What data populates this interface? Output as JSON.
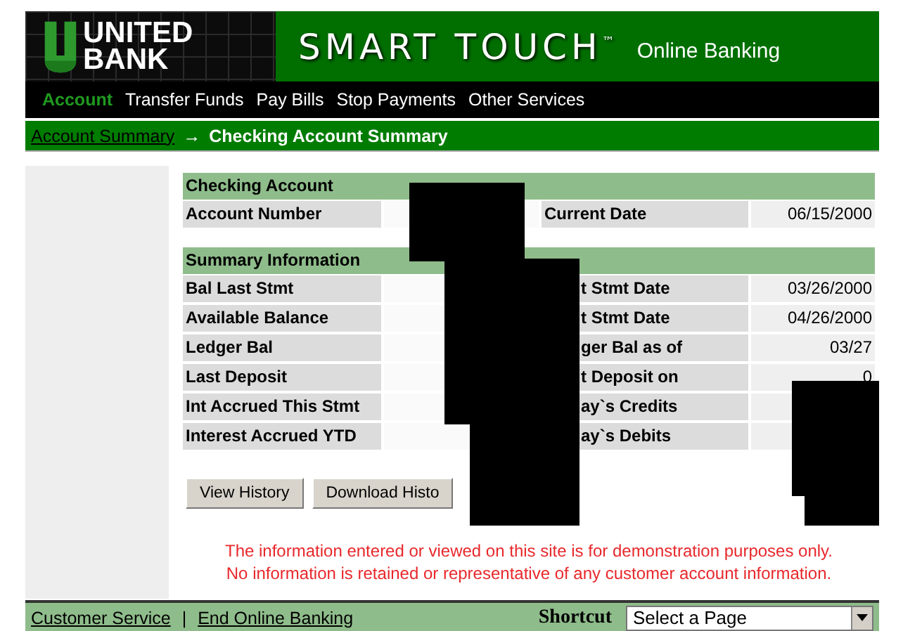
{
  "header": {
    "logo_lines": [
      "UNITED",
      "BANK"
    ],
    "product": "SMART TOUCH",
    "trademark": "™",
    "tagline": "Online Banking"
  },
  "nav": [
    {
      "label": "Account",
      "selected": true
    },
    {
      "label": "Transfer Funds",
      "selected": false
    },
    {
      "label": "Pay Bills",
      "selected": false
    },
    {
      "label": "Stop Payments",
      "selected": false
    },
    {
      "label": "Other Services",
      "selected": false
    }
  ],
  "breadcrumb": {
    "link": "Account Summary",
    "separator": "→",
    "current": "Checking Account Summary"
  },
  "sections": [
    {
      "title": "Checking Account",
      "rows": [
        {
          "label": "Account Number",
          "label_2": "Current Date",
          "value_2": "06/15/2000"
        }
      ]
    },
    {
      "title": "Summary Information",
      "rows": [
        {
          "label": "Bal Last Stmt",
          "label_2": "t Stmt Date",
          "value_2": "03/26/2000"
        },
        {
          "label": "Available Balance",
          "label_2": "t Stmt Date",
          "value_2": "04/26/2000"
        },
        {
          "label": "Ledger Bal",
          "label_2": "ger Bal as of",
          "value_2": "03/27"
        },
        {
          "label": "Last Deposit",
          "label_2": "t Deposit on",
          "value_2": "0"
        },
        {
          "label": "Int Accrued This Stmt",
          "label_2": "ay`s Credits"
        },
        {
          "label": "Interest Accrued YTD",
          "label_2": "ay`s Debits"
        }
      ]
    }
  ],
  "buttons": [
    "View History",
    "Download Histo"
  ],
  "notice": [
    "The information entered or viewed on this site is for demonstration purposes only.",
    "No information is retained or representative of any customer account information."
  ],
  "footer": {
    "links": [
      "Customer Service",
      "End Online Banking"
    ],
    "separator": "|",
    "shortcut_label": "Shortcut",
    "shortcut_select": "Select a Page"
  }
}
